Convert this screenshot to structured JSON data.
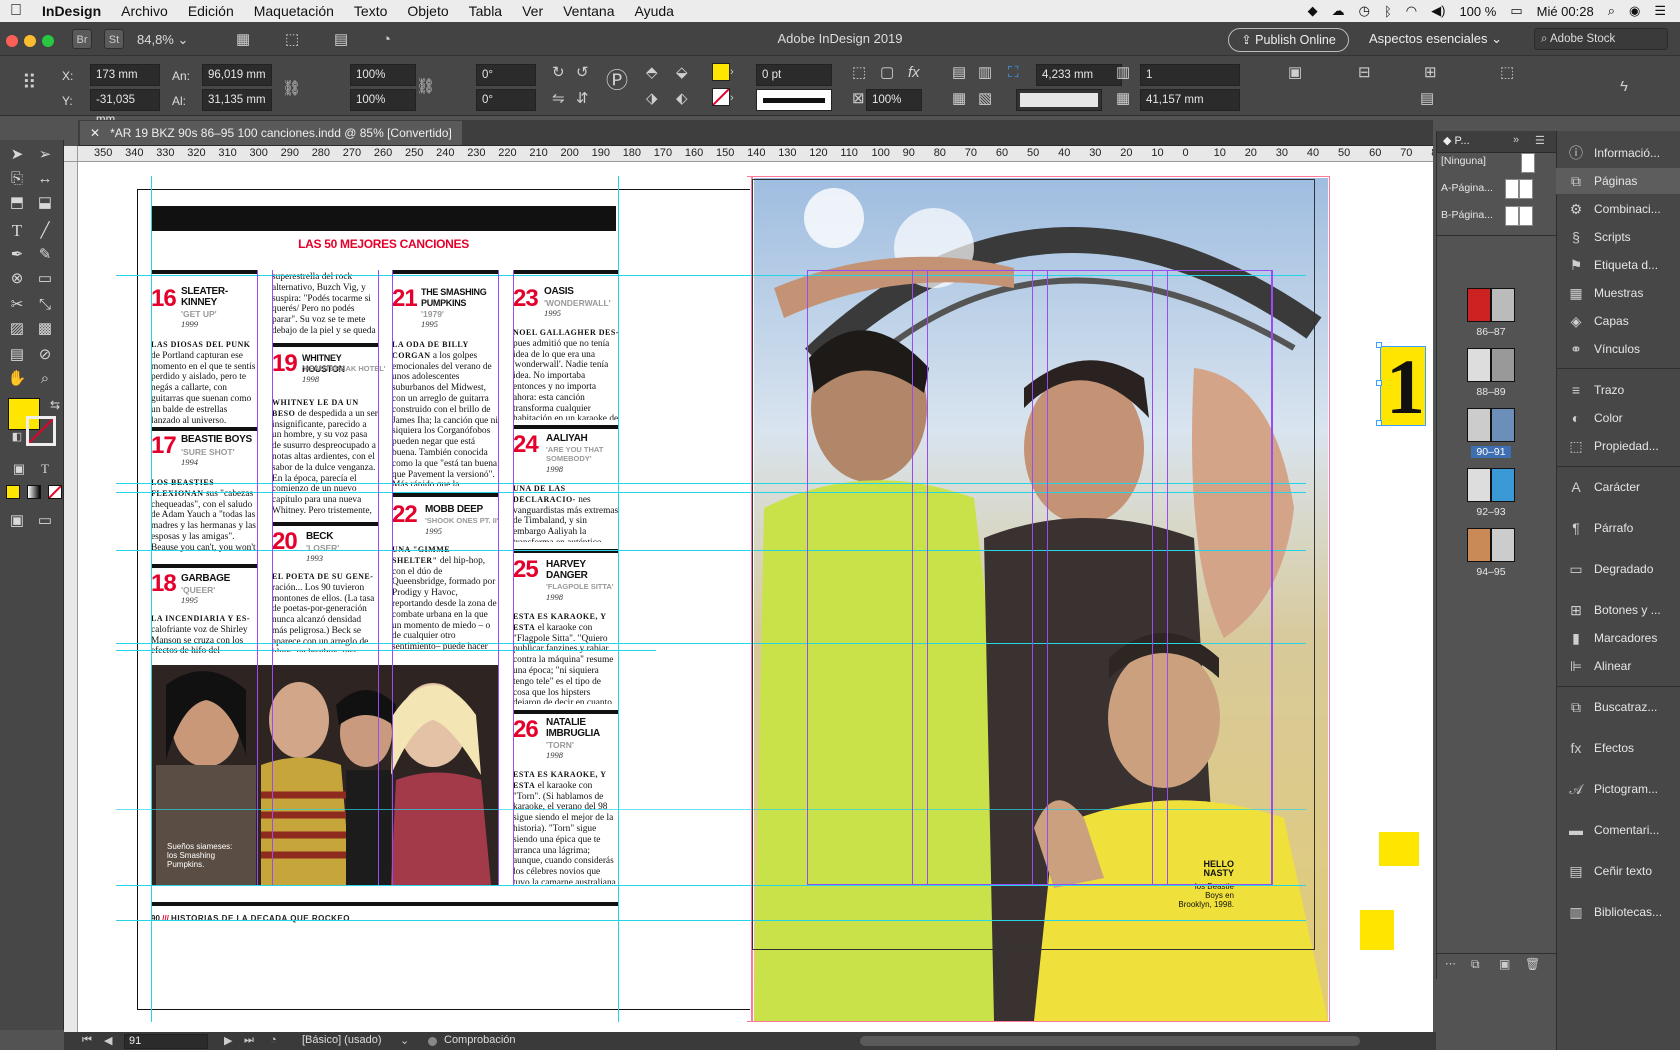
{
  "menubar": {
    "app": "InDesign",
    "items": [
      "Archivo",
      "Edición",
      "Maquetación",
      "Texto",
      "Objeto",
      "Tabla",
      "Ver",
      "Ventana",
      "Ayuda"
    ],
    "battery": "100 %",
    "clock": "Mié 00:28"
  },
  "titlebar": {
    "br": "Br",
    "st": "St",
    "zoom": "84,8%",
    "title": "Adobe InDesign 2019",
    "publish": "Publish Online",
    "workspace": "Aspectos esenciales",
    "stock": "Adobe Stock"
  },
  "control": {
    "x_label": "X:",
    "x": "173 mm",
    "y_label": "Y:",
    "y": "-31,035 mm",
    "w_label": "An:",
    "w": "96,019 mm",
    "h_label": "Al:",
    "h": "31,135 mm",
    "scale_x": "100%",
    "scale_y": "100%",
    "angle": "0°",
    "shear": "0°",
    "stroke": "0 pt",
    "opacity": "100%",
    "ref_w": "4,233 mm",
    "cols": "1",
    "gutter": "41,157 mm"
  },
  "tab": {
    "title": "*AR 19 BKZ 90s 86–95 100 canciones.indd @ 85% [Convertido]"
  },
  "ruler_h": [
    "350",
    "340",
    "330",
    "320",
    "310",
    "300",
    "290",
    "280",
    "270",
    "260",
    "250",
    "240",
    "230",
    "220",
    "210",
    "200",
    "190",
    "180",
    "170",
    "160",
    "150",
    "140",
    "130",
    "120",
    "110",
    "100",
    "90",
    "80",
    "70",
    "60",
    "50",
    "40",
    "30",
    "20",
    "10",
    "0",
    "10",
    "20",
    "30",
    "40",
    "50",
    "60",
    "70",
    "80",
    "90"
  ],
  "spread": {
    "headline": "LAS 50 MEJORES CANCIONES",
    "folio": "90",
    "folio_text": "HISTORIAS DE LA DECADA QUE ROCKEO",
    "photo_caption": "Sueños siameses:\nlos Smashing\nPumpkins.",
    "right_caption_title": "HELLO\nNASTY",
    "right_caption": "los Beastie\nBoys en\nBrooklyn, 1998.",
    "oversize_glyph": "1",
    "songs": [
      {
        "n": "16",
        "band": "SLEATER-\nKINNEY",
        "song": "'GET UP'",
        "year": "1999",
        "lead": "LAS DIOSAS DEL PUNK",
        "body": "de Portland capturan ese momento en el que te sentís perdido y aislado, pero te negás a callarte, con guitarras que suenan como un balde de estrellas lanzado al universo."
      },
      {
        "n": "17",
        "band": "BEASTIE BOYS",
        "song": "'SURE SHOT'",
        "year": "1994",
        "lead": "LOS BEASTIES FLEXIONAN",
        "body": "sus \"cabezas chequeadas\", con el saludo de Adam Yauch a \"todas las madres y las hermanas y las esposas y las amigas\". Beause you can't, you won't and you don't stop."
      },
      {
        "n": "18",
        "band": "GARBAGE",
        "song": "'QUEER'",
        "year": "1995",
        "lead": "LA INCENDIARIA Y ES-",
        "body": "calofriante voz de Shirley Manson se cruza con los efectos de hifo del productor"
      },
      {
        "n": "19",
        "band": "WHITNEY HOUSTON",
        "song": "'HEARTBREAK HOTEL'",
        "year": "1998",
        "lead": "WHITNEY LE DA UN BESO",
        "body": "de despedida a un ser insignificante, parecido a un hombre, y su voz pasa de susurro despreocupado a notas altas ardientes, con el sabor de la dulce venganza. En la época, parecía el comienzo de un nuevo capítulo para una nueva Whitney. Pero tristemente, resultó ser donde la historia terminó."
      },
      {
        "n": "20",
        "band": "BECK",
        "song": "'LOSER'",
        "year": "1993",
        "lead": "EL POETA DE SU GENE-",
        "body": "ración... Los 90 tuvieron montones de ellos. (La tasa de poetas-por-generación nunca alcanzó densidad más peligrosa.) Beck se aparece con un arreglo de blues, un beatbox, una máquina para"
      },
      {
        "n": "21",
        "band": "THE SMASHING\nPUMPKINS",
        "song": "'1979'",
        "year": "1995",
        "lead": "LA ODA DE BILLY CORGAN",
        "body": "a los golpes emocionales del verano de unos adolescentes suburbanos del Midwest, con un arreglo de guitarra construido con el brillo de James Iha; la canción que ni siquiera los Corganófobos pueden negar que está buena. También conocida como la que \"está tan buena que Pavement la versionó\". Más rápido que la velocidad del sonido, más rápido de lo que creíamos que íbamos."
      },
      {
        "n": "22",
        "band": "MOBB DEEP",
        "song": "'SHOOK ONES PT. II'",
        "year": "1995",
        "lead": "UNA \"GIMME SHELTER\"",
        "body": "del hip-hop, con el dúo de Queensbridge, formado por Prodigy y Havoc, reportando desde la zona de combate urbana en la que un momento de miedo – o de cualquier otro sentimiento– puede hacer que te maten, porque no existe tal cosa como un ladrón a medias."
      },
      {
        "n": "23",
        "band": "OASIS",
        "song": "'WONDERWALL'",
        "year": "1995",
        "lead": "NOEL GALLAGHER DES-",
        "body": "pues admitió que no tenía idea de lo que era una 'wonderwall'. Nadie tenía idea. No importaba entonces y no importa ahora: esta canción transforma cualquier habitación en un karaoke de tipos desafinados en un pub."
      },
      {
        "n": "24",
        "band": "AALIYAH",
        "song": "'ARE YOU THAT\nSOMEBODY'",
        "year": "1998",
        "lead": "UNA DE LAS DECLARACIO-",
        "body": "nes vanguardistas más extremas de Timbaland, y sin embargo Aaliyah la transforma en auténtico pop, con sus voces híper cool."
      },
      {
        "n": "25",
        "band": "HARVEY\nDANGER",
        "song": "'FLAGPOLE SITTA'",
        "year": "1998",
        "lead": "ESTA ES KARAOKE, Y ESTA",
        "body": "el karaoke con \"Flagpole Sitta\". \"Quiero publicar fanzines y rabiar contra la máquina\" resume una época; \"ni siquiera tengo tele\" es el tipo de cosa que los hipsters dejaron de decir en cuanto terminaron los 90."
      },
      {
        "n": "26",
        "band": "NATALIE\nIMBRUGLIA",
        "song": "'TORN'",
        "year": "1998",
        "lead": "ESTA ES KARAOKE, Y ESTA",
        "body": "el karaoke con \"Torn\". (Si hablamos de karaoke, el verano del 98 sigue siendo el mejor de la historia). \"Torn\" sigue siendo una épica que te arranca una lágrima; aunque, cuando considerás los célebres novios que tuvo la camarne australiana Natalie Imbruglia, te das cuenta de que esa chica no necesita un"
      }
    ],
    "continued_top": "superestrella del rock alternativo, Buzch Vig, y suspira: \"Podés tocarme si querés/ Pero no podés parar\". Su voz se te mete debajo de la piel y se queda ahí. Miedo."
  },
  "pages": {
    "tab": "P...",
    "none": "[Ninguna]",
    "a_master": "A-Página...",
    "b_master": "B-Página...",
    "spreads": [
      "86–87",
      "88–89",
      "90–91",
      "92–93",
      "94–95"
    ]
  },
  "dock": [
    "Informació...",
    "Páginas",
    "Combinaci...",
    "Scripts",
    "Etiqueta d...",
    "Muestras",
    "Capas",
    "Vínculos",
    "Trazo",
    "Color",
    "Propiedad...",
    "Carácter",
    "Párrafo",
    "Degradado",
    "Botones y ...",
    "Marcadores",
    "Alinear",
    "Buscatraz...",
    "Efectos",
    "Pictogram...",
    "Comentari...",
    "Ceñir texto",
    "Bibliotecas..."
  ],
  "status": {
    "page": "91",
    "profile": "[Básico] (usado)",
    "preflight": "Comprobación"
  },
  "colors": {
    "fill": "#ffe600",
    "accent_red": "#e4002b",
    "guide": "#27d4e6",
    "column_guide": "#9a4bf2",
    "margin": "#ff7a9a"
  }
}
